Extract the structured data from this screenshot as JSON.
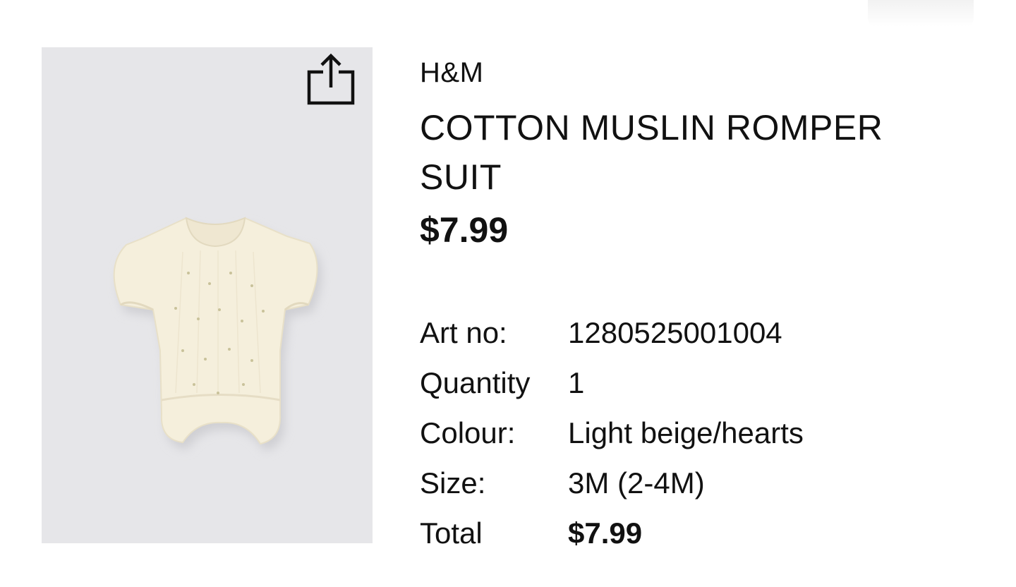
{
  "product": {
    "brand": "H&M",
    "name": "COTTON MUSLIN ROMPER SUIT",
    "price": "$7.99",
    "image_icon": "romper-suit-image",
    "share_icon": "share-icon"
  },
  "details": [
    {
      "label": "Art no:",
      "value": "1280525001004"
    },
    {
      "label": "Quantity",
      "value": "1"
    },
    {
      "label": "Colour:",
      "value": "Light beige/hearts"
    },
    {
      "label": "Size:",
      "value": "3M (2-4M)"
    },
    {
      "label": "Total",
      "value": "$7.99"
    }
  ],
  "colors": {
    "image_background": "#e6e6e9",
    "garment": "#f5efdc",
    "text": "#111111"
  }
}
